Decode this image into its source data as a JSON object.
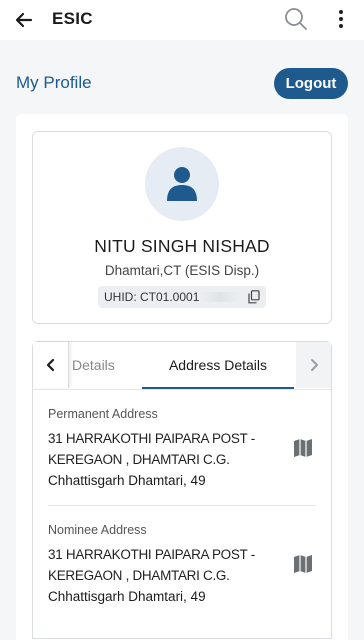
{
  "appbar": {
    "title": "ESIC",
    "back_icon": "arrow-left-icon",
    "search_icon": "search-icon",
    "more_icon": "more-vertical-icon"
  },
  "section": {
    "title": "My Profile",
    "logout_label": "Logout"
  },
  "profile": {
    "avatar_icon": "user-icon",
    "name": "NITU SINGH NISHAD",
    "location": "Dhamtari,CT (ESIS Disp.)",
    "uhid_label": "UHID: CT01.0001",
    "uhid_suffix": "",
    "copy_icon": "copy-icon"
  },
  "tabs": {
    "prev_icon": "chevron-left-icon",
    "next_icon": "chevron-right-icon",
    "items": [
      {
        "label": "Details",
        "active": false
      },
      {
        "label": "Address Details",
        "active": true
      }
    ]
  },
  "addresses": [
    {
      "label": "Permanent Address",
      "lines": [
        "31 HARRAKOTHI PAIPARA POST -",
        "KEREGAON , DHAMTARI C.G.",
        "Chhattisgarh Dhamtari, 49"
      ],
      "map_icon": "map-icon"
    },
    {
      "label": "Nominee Address",
      "lines": [
        "31 HARRAKOTHI PAIPARA POST -",
        "KEREGAON , DHAMTARI C.G.",
        "Chhattisgarh Dhamtari, 49"
      ],
      "map_icon": "map-icon"
    }
  ],
  "colors": {
    "brand": "#1e5a8e",
    "avatar_bg": "#e5ecf3",
    "background": "#f5f6f8"
  }
}
